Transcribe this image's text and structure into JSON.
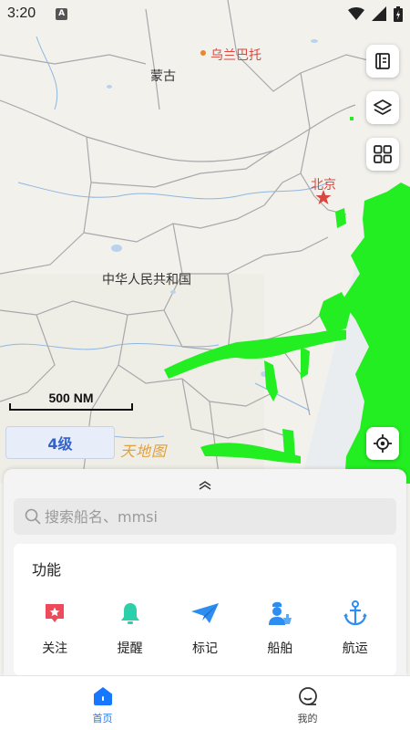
{
  "status_bar": {
    "time": "3:20",
    "a_badge": "A"
  },
  "map": {
    "labels": {
      "mongolia": "蒙古",
      "ulaanbaatar": "乌兰巴托",
      "beijing": "北京",
      "china": "中华人民共和国"
    },
    "scale_label": "500 NM",
    "zoom_level": "4级",
    "provider_logo": "天地图",
    "ship_color": "#22ee22",
    "capital_color": "#d9473f"
  },
  "map_controls": [
    "book-icon",
    "layers-icon",
    "grid-icon",
    "locate-icon"
  ],
  "search": {
    "placeholder": "搜索船名、mmsi"
  },
  "functions": {
    "title": "功能",
    "items": [
      {
        "label": "关注",
        "icon": "follow-star-icon",
        "color": "#ee4b5a"
      },
      {
        "label": "提醒",
        "icon": "bell-icon",
        "color": "#2ad0a8"
      },
      {
        "label": "标记",
        "icon": "paper-plane-icon",
        "color": "#2d8df0"
      },
      {
        "label": "船舶",
        "icon": "ship-captain-icon",
        "color": "#2d8df0"
      },
      {
        "label": "航运",
        "icon": "anchor-icon",
        "color": "#2d8df0"
      }
    ]
  },
  "bottom_nav": {
    "home": "首页",
    "mine": "我的",
    "active": "home",
    "active_color": "#1677ff"
  }
}
